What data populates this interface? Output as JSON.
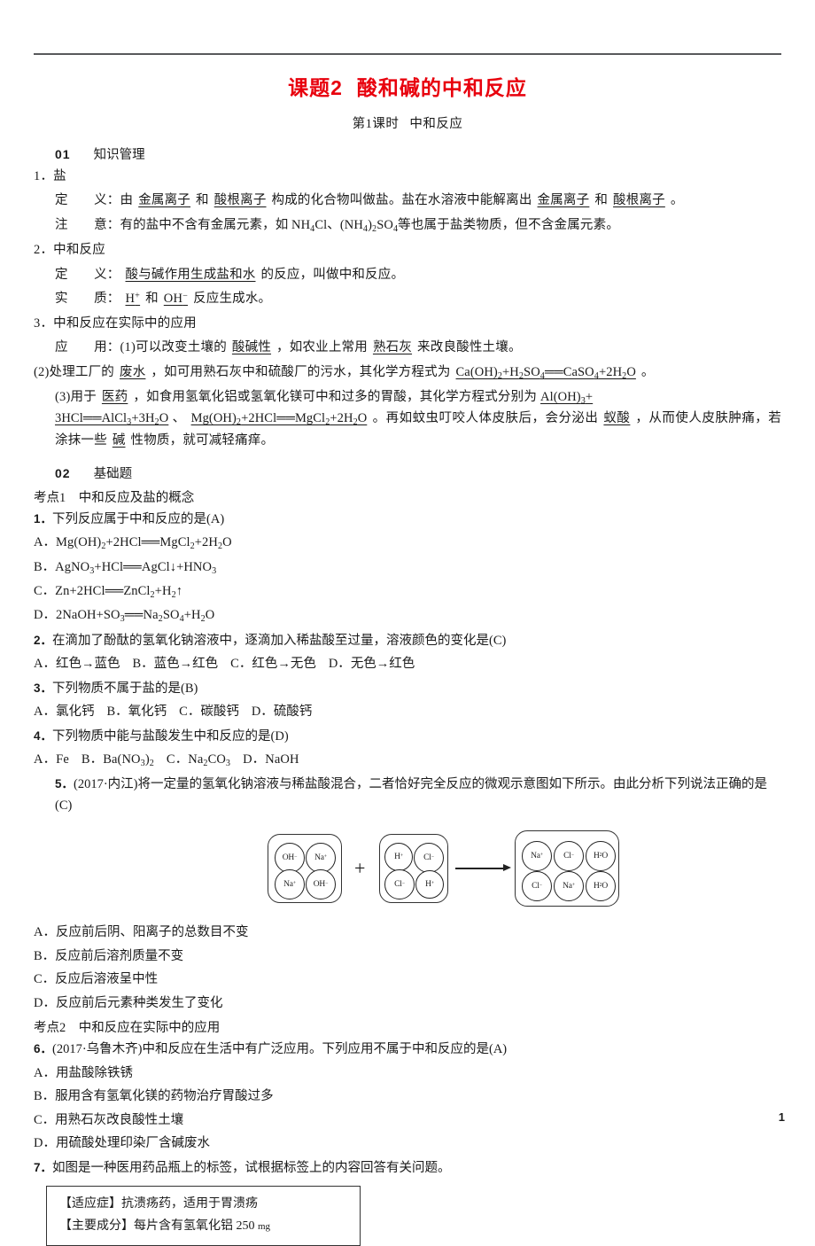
{
  "header": {
    "title_main": "课题2",
    "title_sub": "酸和碱的中和反应",
    "subtitle_left": "第1课时",
    "subtitle_right": "中和反应"
  },
  "section1": {
    "num": "01",
    "name": "知识管理",
    "item1_title": "1．盐",
    "def_label": "定　　义：",
    "def_pre": "由",
    "def_blank1": "金属离子",
    "def_mid1": "和",
    "def_blank2": "酸根离子",
    "def_mid2": "构成的化合物叫做盐。盐在水溶液中能解离出",
    "def_blank3": "金属离子",
    "def_mid3": "和",
    "def_blank4": "酸根离子",
    "def_end": "。",
    "note_label": "注　　意：",
    "note_text_a": "有的盐中不含有金属元素，如 NH",
    "note_text_b": "Cl、(NH",
    "note_text_c": ")",
    "note_text_d": "SO",
    "note_text_e": "等也属于盐类物质，但不含金属元素。",
    "item2_title": "2．中和反应",
    "def2_label": "定　　义：",
    "def2_blank": "酸与碱作用生成盐和水",
    "def2_end": "的反应，叫做中和反应。",
    "essence_label": "实　　质：",
    "essence_blank1": "H",
    "essence_sup1": "+",
    "essence_mid": "和",
    "essence_blank2": "OH",
    "essence_sup2": "−",
    "essence_end": "反应生成水。",
    "item3_title": "3．中和反应在实际中的应用",
    "app_label": "应　　用：",
    "app1_pre": "(1)可以改变土壤的",
    "app1_blank1": "酸碱性",
    "app1_mid": "，如农业上常用",
    "app1_blank2": "熟石灰",
    "app1_end": "来改良酸性土壤。",
    "app2_pre": "(2)处理工厂的",
    "app2_blank": "废水",
    "app2_mid": "，如可用熟石灰中和硫酸厂的污水，其化学方程式为",
    "app2_formula": "Ca(OH)2+H2SO4══CaSO4+2H2O",
    "app2_end": "。",
    "app3_pre": "(3)用于",
    "app3_blank": "医药",
    "app3_mid": "，如食用氢氧化铝或氢氧化镁可中和过多的胃酸，其化学方程式分别为",
    "app3_formula1_a": "Al(OH)3+",
    "app3_formula1_b": "3HCl══AlCl3+3H2O",
    "app3_sep": "、",
    "app3_formula2": "Mg(OH)2+2HCl══MgCl2+2H2O",
    "app3_after": "。再如蚊虫叮咬人体皮肤后，会分泌出",
    "app3_blank2": "蚁酸",
    "app3_mid2": "，从而使人皮肤肿痛，若涂抹一些",
    "app3_blank3": "碱",
    "app3_end": "性物质，就可减轻痛痒。"
  },
  "section2": {
    "num": "02",
    "name": "基础题",
    "kaodian1": "考点1　中和反应及盐的概念",
    "q1": {
      "num": "1．",
      "text": "下列反应属于中和反应的是(A)",
      "options": [
        {
          "label": "A．",
          "text": "Mg(OH)2+2HCl══MgCl2+2H2O"
        },
        {
          "label": "B．",
          "text": "AgNO3+HCl══AgCl↓+HNO3"
        },
        {
          "label": "C．",
          "text": "Zn+2HCl══ZnCl2+H2↑"
        },
        {
          "label": "D．",
          "text": "2NaOH+SO3══Na2SO4+H2O"
        }
      ]
    },
    "q2": {
      "num": "2．",
      "text": "在滴加了酚酞的氢氧化钠溶液中，逐滴加入稀盐酸至过量，溶液颜色的变化是(C)",
      "options_inline": [
        {
          "label": "A．",
          "text": "红色→蓝色"
        },
        {
          "label": "B．",
          "text": "蓝色→红色"
        },
        {
          "label": "C．",
          "text": "红色→无色"
        },
        {
          "label": "D．",
          "text": "无色→红色"
        }
      ]
    },
    "q3": {
      "num": "3．",
      "text": "下列物质不属于盐的是(B)",
      "options_inline": [
        {
          "label": "A．",
          "text": "氯化钙"
        },
        {
          "label": "B．",
          "text": "氧化钙"
        },
        {
          "label": "C．",
          "text": "碳酸钙"
        },
        {
          "label": "D．",
          "text": "硫酸钙"
        }
      ]
    },
    "q4": {
      "num": "4．",
      "text": "下列物质中能与盐酸发生中和反应的是(D)",
      "options_inline": [
        {
          "label": "A．",
          "text": "Fe"
        },
        {
          "label": "B．",
          "text": "Ba(NO3)2"
        },
        {
          "label": "C．",
          "text": "Na2CO3"
        },
        {
          "label": "D．",
          "text": "NaOH"
        }
      ]
    },
    "q5": {
      "num": "5．",
      "text": "(2017·内江)将一定量的氢氧化钠溶液与稀盐酸混合，二者恰好完全反应的微观示意图如下所示。由此分析下列说法正确的是(C)",
      "options": [
        {
          "label": "A．",
          "text": "反应前后阴、阳离子的总数目不变"
        },
        {
          "label": "B．",
          "text": "反应前后溶剂质量不变"
        },
        {
          "label": "C．",
          "text": "反应后溶液呈中性"
        },
        {
          "label": "D．",
          "text": "反应前后元素种类发生了变化"
        }
      ]
    },
    "kaodian2": "考点2　中和反应在实际中的应用",
    "q6": {
      "num": "6．",
      "text": "(2017·乌鲁木齐)中和反应在生活中有广泛应用。下列应用不属于中和反应的是(A)",
      "options": [
        {
          "label": "A．",
          "text": "用盐酸除铁锈"
        },
        {
          "label": "B．",
          "text": "服用含有氢氧化镁的药物治疗胃酸过多"
        },
        {
          "label": "C．",
          "text": "用熟石灰改良酸性土壤"
        },
        {
          "label": "D．",
          "text": "用硫酸处理印染厂含碱废水"
        }
      ]
    },
    "q7": {
      "num": "7．",
      "text": "如图是一种医用药品瓶上的标签，试根据标签上的内容回答有关问题。"
    }
  },
  "diagram": {
    "group1": [
      {
        "base": "OH",
        "charge": "−"
      },
      {
        "base": "Na",
        "charge": "+"
      },
      {
        "base": "Na",
        "charge": "+"
      },
      {
        "base": "OH",
        "charge": "−"
      }
    ],
    "group2": [
      {
        "base": "H",
        "charge": "+"
      },
      {
        "base": "Cl",
        "charge": "−"
      },
      {
        "base": "Cl",
        "charge": "−"
      },
      {
        "base": "H",
        "charge": "+"
      }
    ],
    "group3": [
      {
        "base": "Na",
        "charge": "+"
      },
      {
        "base": "Cl",
        "charge": "−"
      },
      {
        "base": "H2O",
        "charge": ""
      },
      {
        "base": "Cl",
        "charge": "−"
      },
      {
        "base": "Na",
        "charge": "+"
      },
      {
        "base": "H2O",
        "charge": ""
      }
    ],
    "plus": "+"
  },
  "drug_label": {
    "line1": "【适应症】抗溃疡药，适用于胃溃疡",
    "line2_a": "【主要成分】每片含有氢氧化铝 250",
    "line2_b": "mg"
  },
  "footer": {
    "page_number": "1"
  },
  "colors": {
    "title_red": "#e8000d",
    "rule_gray": "#58595b",
    "text": "#1a1a1a"
  }
}
